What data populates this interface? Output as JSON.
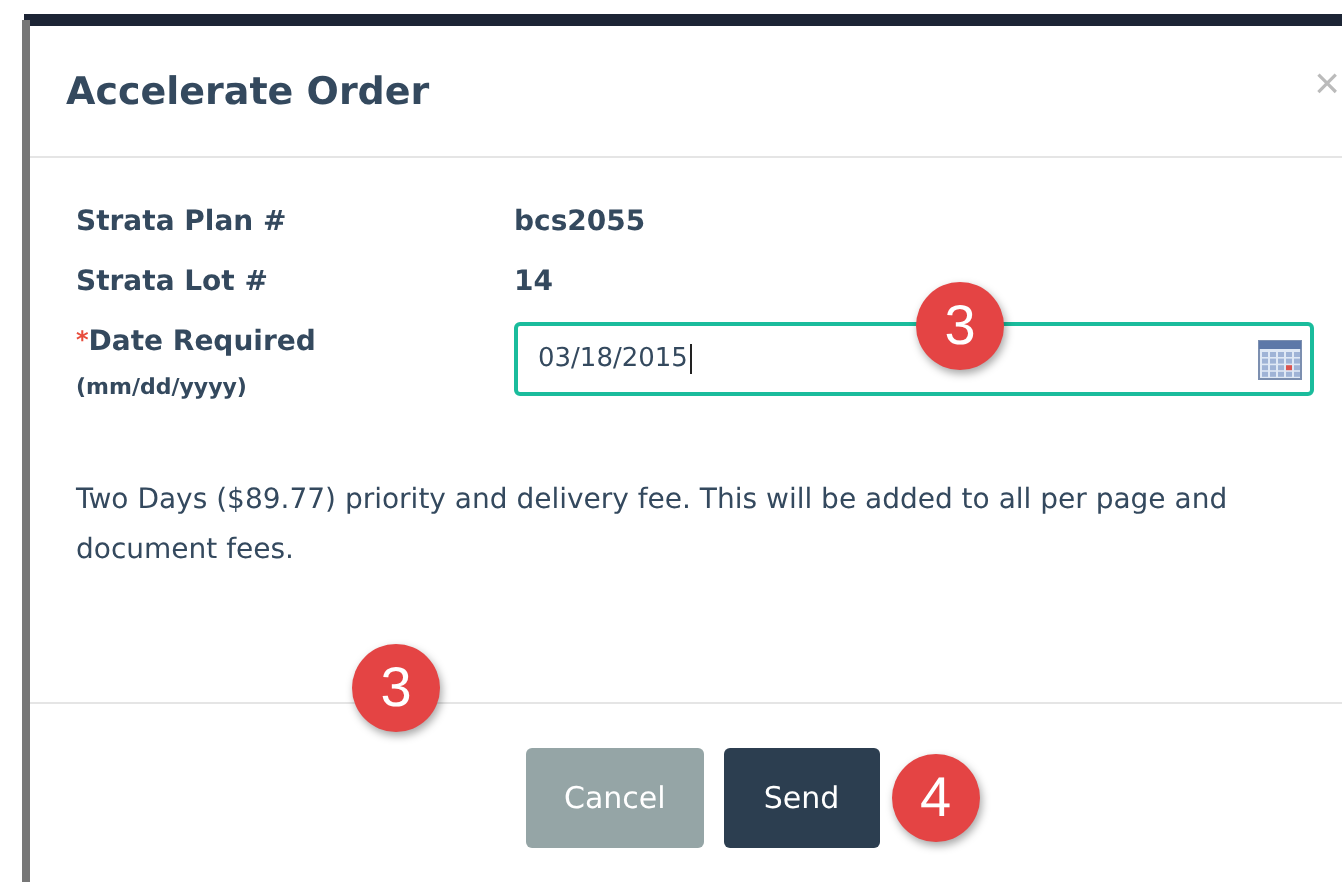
{
  "dialog": {
    "title": "Accelerate Order",
    "close": "×",
    "fields": [
      {
        "kind": "static",
        "label": "Strata Plan #",
        "value": "bcs2055"
      },
      {
        "kind": "static",
        "label": "Strata Lot #",
        "value": "14"
      },
      {
        "kind": "date",
        "required_mark": "*",
        "label": "Date Required",
        "hint": "(mm/dd/yyyy)",
        "value": "03/18/2015",
        "focused": true,
        "callout": "3"
      }
    ],
    "note": "Two Days ($89.77) priority and delivery fee. This will be added to all per page and document fees.",
    "note_callout": "3",
    "buttons": [
      {
        "kind": "secondary",
        "label": "Cancel"
      },
      {
        "kind": "primary",
        "label": "Send",
        "callout": "4"
      }
    ]
  }
}
